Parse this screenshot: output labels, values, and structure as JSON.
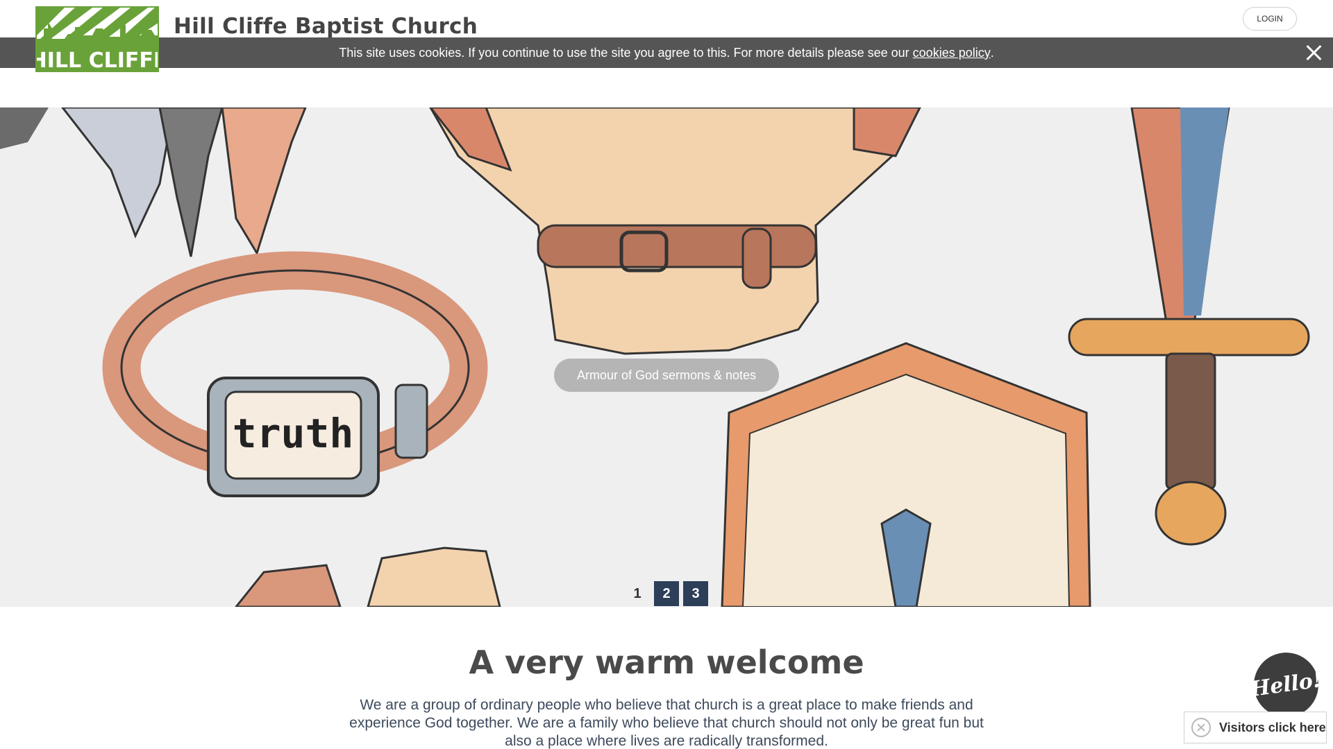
{
  "header": {
    "logo_text": "HILL CLIFFE",
    "site_title": "Hill Cliffe Baptist Church",
    "login_label": "LOGIN"
  },
  "cookie_bar": {
    "message": "This site uses cookies. If you continue to use the site you agree to this. For more details please see our",
    "link_text": "cookies policy",
    "suffix": "."
  },
  "hero": {
    "button_label": "Armour of God sermons & notes",
    "belt_word": "truth",
    "pager": [
      "1",
      "2",
      "3"
    ],
    "active_page": "1"
  },
  "welcome": {
    "title": "A very warm welcome",
    "text": "We are a group of ordinary people who believe that church is a great place to make friends and experience God together. We are a family who believe that church should not only be great fun but also a place where lives are radically transformed."
  },
  "widget": {
    "hello_label": "Hello!",
    "visitors_label": "Visitors click here"
  },
  "colors": {
    "brand_green": "#6aa23a",
    "cookie_bg": "#555555",
    "pager_active": "#2c3e58",
    "hero_button": "#b5b5b5"
  }
}
